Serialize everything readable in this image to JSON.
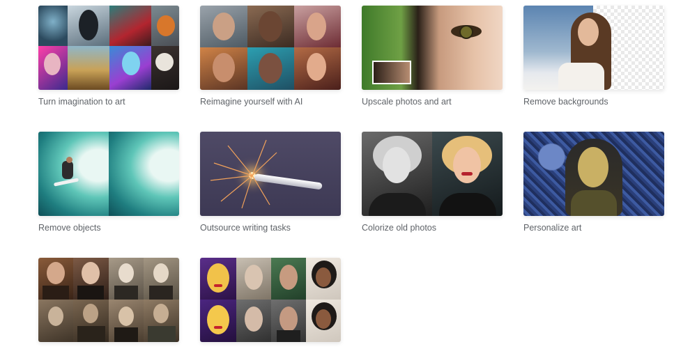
{
  "cards": [
    {
      "caption": "Turn imagination to art"
    },
    {
      "caption": "Reimagine yourself with AI"
    },
    {
      "caption": "Upscale photos and art"
    },
    {
      "caption": "Remove backgrounds"
    },
    {
      "caption": "Remove objects"
    },
    {
      "caption": "Outsource writing tasks"
    },
    {
      "caption": "Colorize old photos"
    },
    {
      "caption": "Personalize art"
    },
    {
      "caption": ""
    },
    {
      "caption": ""
    }
  ]
}
